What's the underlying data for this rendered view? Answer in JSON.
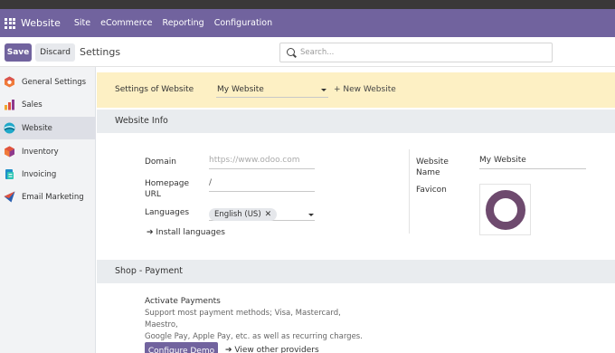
{
  "colors": {
    "brand": "#71639e",
    "banner": "#fdf0c4",
    "section": "#e9ecef",
    "sidebar": "#f2f3f5"
  },
  "navbar": {
    "brand": "Website",
    "items": [
      "Site",
      "eCommerce",
      "Reporting",
      "Configuration"
    ]
  },
  "control": {
    "save_label": "Save",
    "discard_label": "Discard",
    "title": "Settings",
    "search_placeholder": "Search..."
  },
  "sidebar": {
    "items": [
      {
        "label": "General Settings",
        "icon": "general-settings-icon"
      },
      {
        "label": "Sales",
        "icon": "sales-icon"
      },
      {
        "label": "Website",
        "icon": "website-icon",
        "active": true
      },
      {
        "label": "Inventory",
        "icon": "inventory-icon"
      },
      {
        "label": "Invoicing",
        "icon": "invoicing-icon"
      },
      {
        "label": "Email Marketing",
        "icon": "email-marketing-icon"
      }
    ]
  },
  "website_banner": {
    "label": "Settings of Website",
    "selected": "My Website",
    "new_label": "New Website"
  },
  "website_info": {
    "heading": "Website Info",
    "domain_label": "Domain",
    "domain_placeholder": "https://www.odoo.com",
    "homepage_label_1": "Homepage",
    "homepage_label_2": "URL",
    "homepage_value": "/",
    "languages_label": "Languages",
    "language_tag": "English (US)",
    "install_languages": "Install languages",
    "website_name_label_1": "Website",
    "website_name_label_2": "Name",
    "website_name_value": "My Website",
    "favicon_label": "Favicon"
  },
  "shop_payment": {
    "heading": "Shop - Payment",
    "activate_title": "Activate Payments",
    "activate_desc_1": "Support most payment methods; Visa, Mastercard, Maestro,",
    "activate_desc_2": "Google Pay, Apple Pay, etc. as well as recurring charges.",
    "configure_demo": "Configure Demo",
    "view_providers": "View other providers"
  }
}
